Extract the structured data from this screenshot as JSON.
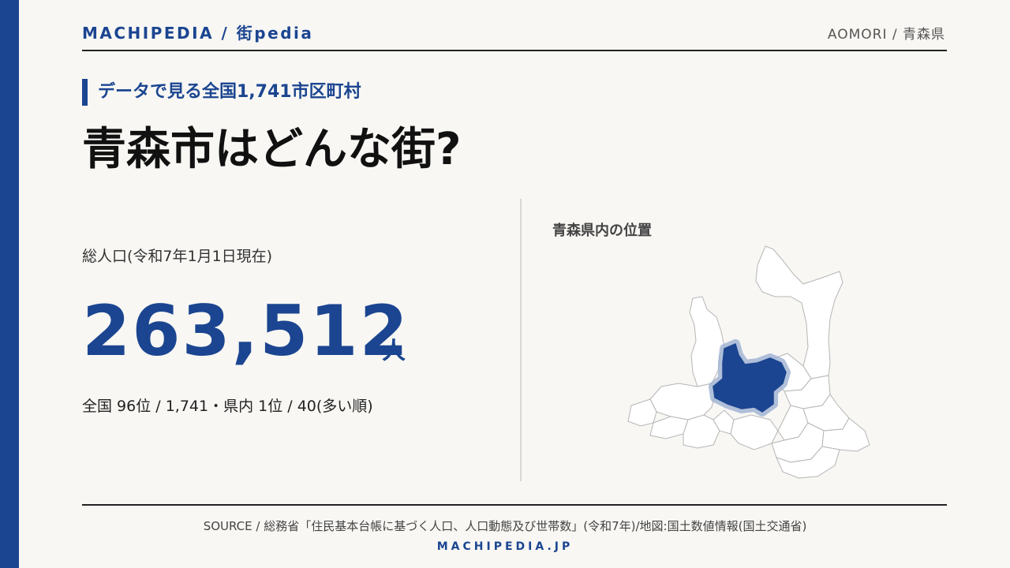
{
  "header": {
    "brand": "MACHIPEDIA / 街pedia",
    "region": "AOMORI / 青森県"
  },
  "hero": {
    "subtitle": "データで見る全国1,741市区町村",
    "title": "青森市はどんな街?"
  },
  "population": {
    "label": "総人口(令和7年1月1日現在)",
    "value": "263,512",
    "unit": "人",
    "rank": "全国 96位 / 1,741・県内 1位 / 40(多い順)"
  },
  "map": {
    "title": "青森県内の位置",
    "highlight_color": "#1b4590",
    "halo_color": "#9fb2d3",
    "base_fill": "#ffffff",
    "border_color": "#b5b5b5"
  },
  "footer": {
    "source": "SOURCE / 総務省「住民基本台帳に基づく人口、人口動態及び世帯数」(令和7年)/地図:国土数値情報(国土交通省)",
    "brand": "MACHIPEDIA.JP"
  },
  "colors": {
    "accent": "#1b4590",
    "background": "#f8f7f4"
  }
}
